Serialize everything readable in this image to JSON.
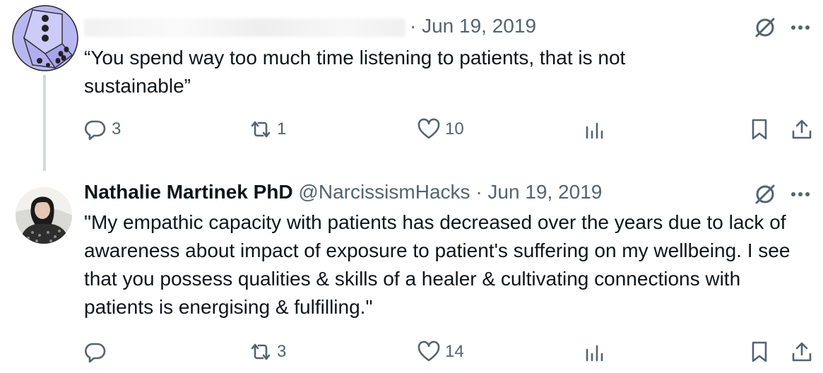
{
  "tweets": [
    {
      "author_name": "",
      "author_handle": "",
      "date": "· Jun 19, 2019",
      "text": "“You spend way too much time listening to patients, that is not sustainable”",
      "stats": {
        "replies": "3",
        "retweets": "1",
        "likes": "10"
      },
      "avatar": "dice-avatar"
    },
    {
      "author_name": "Nathalie Martinek PhD",
      "author_handle": "@NarcissismHacks",
      "date": "· Jun 19, 2019",
      "text": "\"My empathic capacity with patients has decreased over the years due to lack of awareness about impact of exposure to patient's suffering on my wellbeing. I see that you possess qualities & skills of a healer & cultivating connections with patients is energising & fulfilling.\"",
      "stats": {
        "replies": "",
        "retweets": "3",
        "likes": "14"
      },
      "avatar": "photo-avatar"
    }
  ],
  "icons": {
    "reply": "reply-icon",
    "retweet": "retweet-icon",
    "like": "heart-icon",
    "views": "views-icon",
    "bookmark": "bookmark-icon",
    "share": "share-icon",
    "grok": "grok-icon",
    "more": "more-icon"
  },
  "colors": {
    "text": "#0f1419",
    "secondary": "#536471",
    "avatar_dice": "#b9b7f2"
  }
}
